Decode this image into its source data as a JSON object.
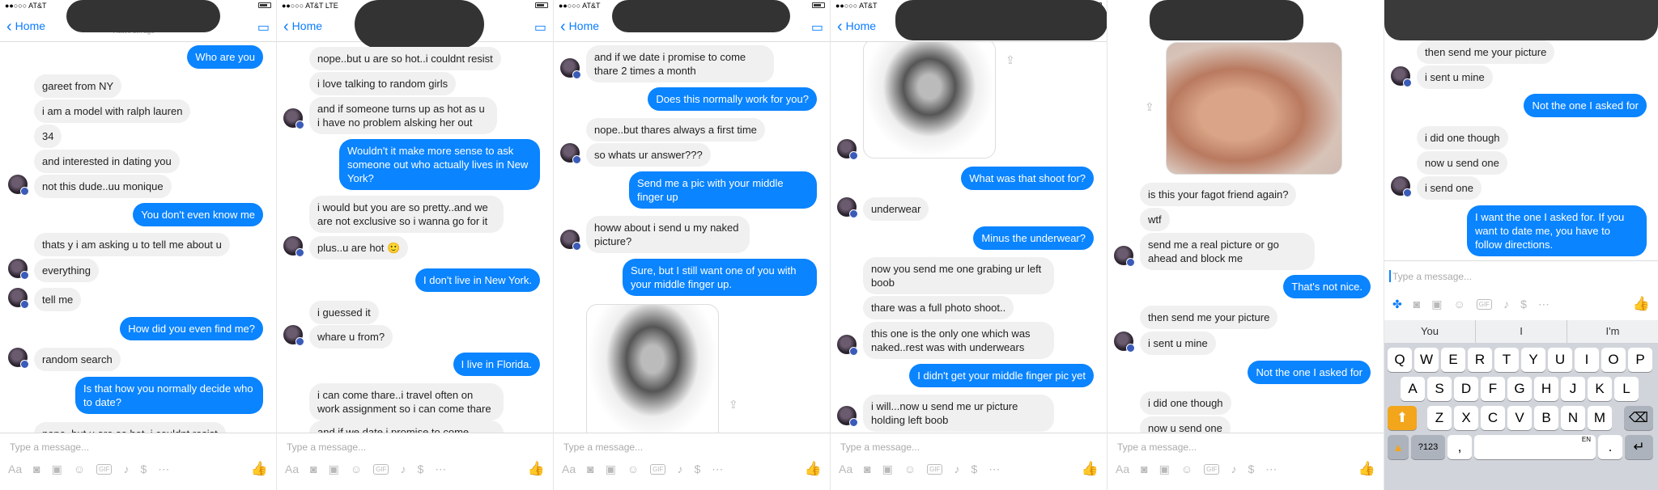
{
  "status_carrier": "●●○○○ AT&T",
  "status_carrier_lte": "●●○○○ AT&T   LTE",
  "back_label": "Home",
  "nav_sub_1": "Active 5m ago",
  "composer_placeholder": "Type a message...",
  "composer_aa": "Aa",
  "gif_label": "GIF",
  "panels": [
    {
      "messages": [
        "Who are you",
        "gareet from NY",
        "i am a model with ralph lauren",
        "34",
        "and interested in dating you",
        "not this dude..uu monique",
        "You don't even know me",
        "thats y i am asking u to tell me about u",
        "everything",
        "tell me",
        "How did you even find me?",
        "random search",
        "Is that how you normally decide who to date?",
        "nope..but u are so hot..i couldnt resist"
      ]
    },
    {
      "messages": [
        "nope..but u are so hot..i couldnt resist",
        "i love talking to random girls",
        "and if someone turns up as hot as u i have no problem alsking her out",
        "Wouldn't it make more sense to ask someone out who actually lives in New York?",
        "i would but you are so pretty..and we are not exclusive so i wanna go for it",
        "plus..u are hot 🙂",
        "I don't live in New York.",
        "i guessed it",
        "whare u from?",
        "I live in Florida.",
        "i can come thare..i travel often on work assignment so i can come thare",
        "and if we date i promise to come thare"
      ]
    },
    {
      "messages": [
        "and if we date i promise to come thare 2 times a month",
        "Does this normally work for you?",
        "nope..but thares always a first time",
        "so whats ur answer???",
        "Send me a pic with your middle finger up",
        "howw about i send u my naked picture?",
        "Sure, but I still want one of you with your middle finger up."
      ]
    },
    {
      "messages": [
        "What was that shoot for?",
        "underwear",
        "Minus the underwear?",
        "now you send me one grabing ur left boob",
        "thare was a full photo shoot..",
        "this one is the only one which was naked..rest was with underwears",
        "I didn't get your middle finger pic yet",
        "i will...now u send me ur picture holding left boob"
      ]
    },
    {
      "messages": [
        "is this your fagot friend again?",
        "wtf",
        "send me a real picture or go ahead and block me",
        "That's not nice.",
        "then send me your picture",
        "i sent u mine",
        "Not the one I asked for",
        "i did one though",
        "now u send one"
      ]
    },
    {
      "messages": [
        "then send me your picture",
        "i sent u mine",
        "Not the one I asked for",
        "i did one though",
        "now u send one",
        "i send one",
        "I want the one I asked for. If you want to date me, you have to follow directions."
      ],
      "suggestions": [
        "You",
        "I",
        "I'm"
      ],
      "keys_row1": [
        "Q",
        "W",
        "E",
        "R",
        "T",
        "Y",
        "U",
        "I",
        "O",
        "P"
      ],
      "keys_row2": [
        "A",
        "S",
        "D",
        "F",
        "G",
        "H",
        "J",
        "K",
        "L"
      ],
      "keys_row3": [
        "Z",
        "X",
        "C",
        "V",
        "B",
        "N",
        "M"
      ],
      "key_123": "?123",
      "key_comma": ",",
      "key_en": "EN",
      "key_period": "."
    }
  ],
  "colors": {
    "outgoing_bubble": "#0a84ff",
    "incoming_bubble": "#f0f0f0",
    "accent": "#0a7cff"
  }
}
